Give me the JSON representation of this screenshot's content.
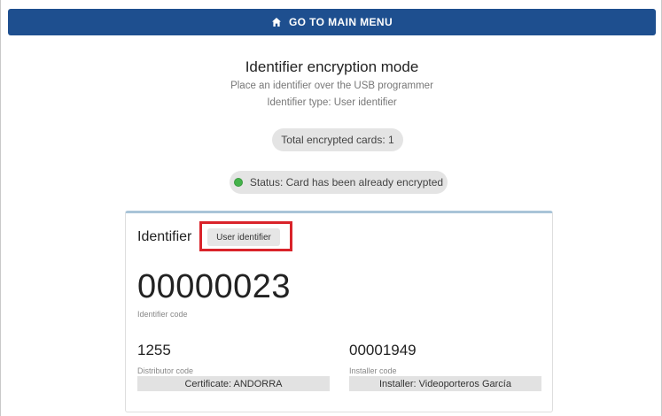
{
  "topbar": {
    "label": "GO TO MAIN MENU",
    "icon": "home-icon"
  },
  "header": {
    "title": "Identifier encryption mode",
    "instruction": "Place an identifier over the USB programmer",
    "identifier_type": "Identifier type: User identifier"
  },
  "total_pill": {
    "text": "Total encrypted cards: 1"
  },
  "status_pill": {
    "text": "Status: Card has been already encrypted",
    "dot_color": "#44b24a"
  },
  "card": {
    "heading": "Identifier",
    "type_badge": "User identifier",
    "highlight_color": "#d9232a",
    "identifier_code": {
      "value": "00000023",
      "label": "Identifier code"
    },
    "distributor": {
      "value": "1255",
      "label": "Distributor code",
      "certificate": "Certificate: ANDORRA"
    },
    "installer": {
      "value": "00001949",
      "label": "Installer code",
      "certificate": "Installer: Videoporteros García"
    }
  },
  "colors": {
    "topbar": "#1e4f8f",
    "card_top_border": "#a9c4d8",
    "pill_bg": "#e4e4e4"
  }
}
